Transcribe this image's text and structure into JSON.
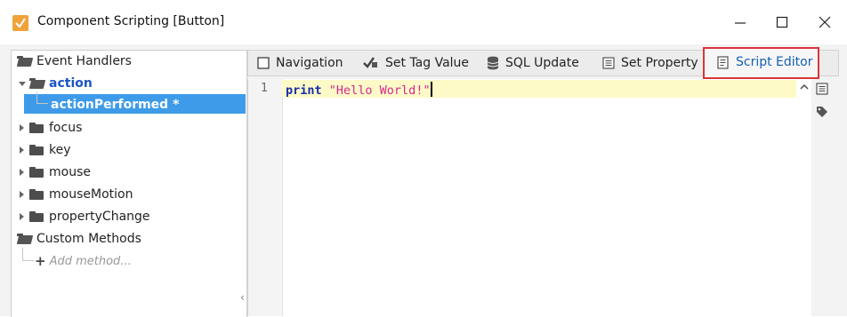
{
  "window": {
    "title": "Component Scripting [Button]",
    "minimize_glyph": "—",
    "maximize_glyph": "☐",
    "close_glyph": "✕"
  },
  "tree": {
    "event_handlers_label": "Event Handlers",
    "action_label": "action",
    "action_performed_label": "actionPerformed *",
    "items": [
      {
        "label": "focus"
      },
      {
        "label": "key"
      },
      {
        "label": "mouse"
      },
      {
        "label": "mouseMotion"
      },
      {
        "label": "propertyChange"
      }
    ],
    "custom_methods_label": "Custom Methods",
    "add_method_label": "Add method..."
  },
  "tabs": {
    "navigation": "Navigation",
    "set_tag_value": "Set Tag Value",
    "sql_update": "SQL Update",
    "set_property": "Set Property",
    "script_editor": "Script Editor",
    "active": "Script Editor"
  },
  "editor": {
    "line_number": "1",
    "keyword": "print",
    "string_literal": "\"Hello World!\""
  },
  "colors": {
    "selection": "#3d9be9",
    "highlight_border": "#d9343a",
    "keyword": "#1a2ea8",
    "string": "#d6288f",
    "current_line": "#fdfac8",
    "app_icon": "#f0a23b"
  }
}
